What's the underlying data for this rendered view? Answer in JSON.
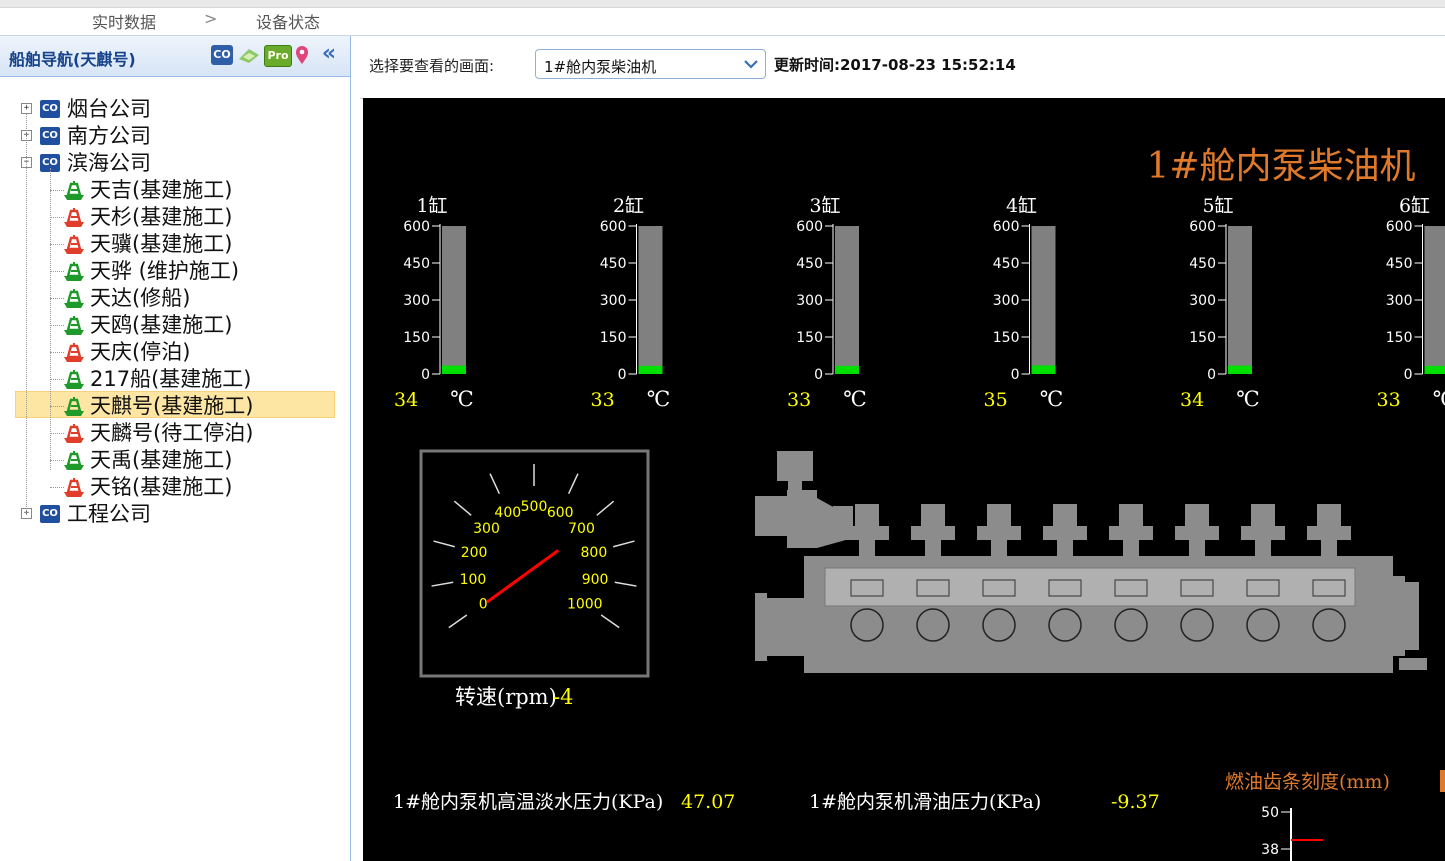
{
  "breadcrumb": {
    "items": [
      "实时数据",
      "设备状态"
    ],
    "separator": ">"
  },
  "nav": {
    "title": "船舶导航(天麒号)",
    "tools": [
      "CO",
      "Pro"
    ],
    "collapse_glyph": "«",
    "tree": [
      {
        "label": "烟台公司",
        "type": "company",
        "expanded": false
      },
      {
        "label": "南方公司",
        "type": "company",
        "expanded": false
      },
      {
        "label": "滨海公司",
        "type": "company",
        "expanded": true
      },
      {
        "label": "天吉(基建施工)",
        "type": "ship",
        "status": "green"
      },
      {
        "label": "天杉(基建施工)",
        "type": "ship",
        "status": "red"
      },
      {
        "label": "天骥(基建施工)",
        "type": "ship",
        "status": "red"
      },
      {
        "label": "天骅 (维护施工)",
        "type": "ship",
        "status": "green"
      },
      {
        "label": "天达(修船)",
        "type": "ship",
        "status": "green"
      },
      {
        "label": "天鸥(基建施工)",
        "type": "ship",
        "status": "green"
      },
      {
        "label": "天庆(停泊)",
        "type": "ship",
        "status": "red"
      },
      {
        "label": "217船(基建施工)",
        "type": "ship",
        "status": "green"
      },
      {
        "label": "天麒号(基建施工)",
        "type": "ship",
        "status": "green",
        "selected": true
      },
      {
        "label": "天麟号(待工停泊)",
        "type": "ship",
        "status": "red"
      },
      {
        "label": "天禹(基建施工)",
        "type": "ship",
        "status": "green"
      },
      {
        "label": "天铭(基建施工)",
        "type": "ship",
        "status": "red"
      },
      {
        "label": "工程公司",
        "type": "company",
        "expanded": false
      }
    ]
  },
  "toolbar": {
    "select_label": "选择要查看的画面:",
    "select_value": "1#舱内泵柴油机",
    "update_label": "更新时间:",
    "update_time": "2017-08-23 15:52:14"
  },
  "scada": {
    "title": "1#舱内泵柴油机",
    "unit": "℃",
    "scale": [
      "600",
      "450",
      "300",
      "150",
      "0"
    ],
    "cylinders": [
      {
        "name": "1缸",
        "value": "34"
      },
      {
        "name": "2缸",
        "value": "33"
      },
      {
        "name": "3缸",
        "value": "33"
      },
      {
        "name": "4缸",
        "value": "35"
      },
      {
        "name": "5缸",
        "value": "34"
      },
      {
        "name": "6缸",
        "value": "33"
      }
    ],
    "gauge": {
      "ticks": [
        "0",
        "100",
        "200",
        "300",
        "400",
        "500",
        "600",
        "700",
        "800",
        "900",
        "1000"
      ],
      "label": "转速(rpm)",
      "value": "-4"
    },
    "readouts": [
      {
        "label": "1#舱内泵机高温淡水压力(KPa)",
        "value": "47.07"
      },
      {
        "label": "1#舱内泵机滑油压力(KPa)",
        "value": "-9.37"
      }
    ],
    "fuel": {
      "label": "燃油齿条刻度(mm)",
      "scale": [
        "50",
        "38"
      ]
    },
    "colors": {
      "bar": "#808080",
      "fill": "#00e000",
      "title": "#e07a2a",
      "value": "#ffff00",
      "needle": "#ff0000"
    }
  }
}
